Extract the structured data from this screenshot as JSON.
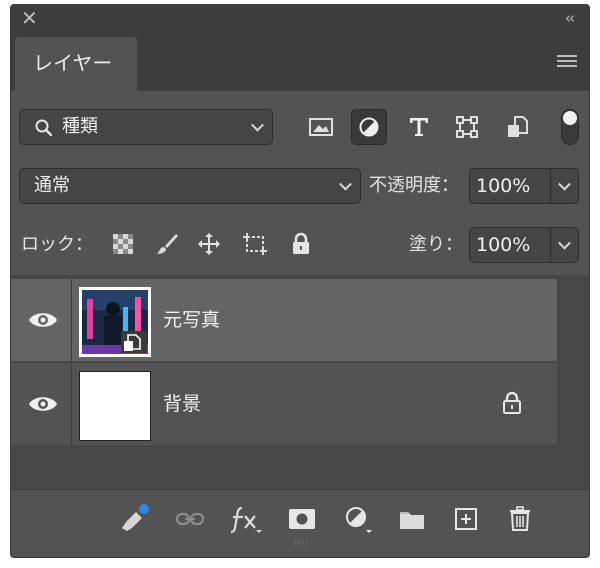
{
  "window": {
    "close_glyph": "✕",
    "collapse_glyph": "‹‹"
  },
  "tabs": [
    {
      "label": "レイヤー"
    }
  ],
  "filter": {
    "kind_label": "種類",
    "kind_icon": "search-icon",
    "filter_icons": [
      "image-filter-icon",
      "adjustment-filter-icon",
      "type-filter-icon",
      "shape-filter-icon",
      "smart-object-filter-icon"
    ]
  },
  "blend": {
    "mode": "通常",
    "opacity_label": "不透明度：",
    "opacity_value": "100%"
  },
  "lock": {
    "label": "ロック：",
    "fill_label": "塗り：",
    "fill_value": "100%"
  },
  "layers": [
    {
      "name": "元写真",
      "visible": true,
      "selected": true,
      "smart_object": true
    },
    {
      "name": "背景",
      "visible": true,
      "selected": false,
      "locked": true
    }
  ],
  "colors": {
    "panel": "#535353",
    "dark": "#3d3d3d",
    "selected_row": "#646464",
    "badge_blue": "#2e8ae6"
  }
}
